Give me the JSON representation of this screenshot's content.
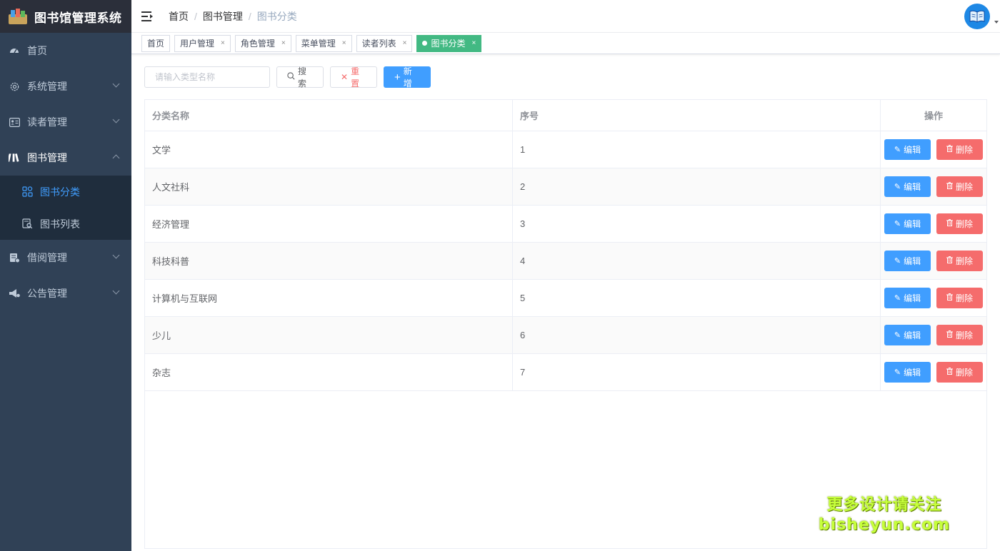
{
  "app": {
    "title": "图书馆管理系统"
  },
  "sidebar": {
    "items": [
      {
        "label": "首页",
        "icon": "dashboard-icon"
      },
      {
        "label": "系统管理",
        "icon": "gear-icon"
      },
      {
        "label": "读者管理",
        "icon": "id-card-icon"
      },
      {
        "label": "图书管理",
        "icon": "books-icon",
        "open": true,
        "children": [
          {
            "label": "图书分类",
            "icon": "category-grid-icon",
            "active": true
          },
          {
            "label": "图书列表",
            "icon": "list-search-icon"
          }
        ]
      },
      {
        "label": "借阅管理",
        "icon": "borrow-icon"
      },
      {
        "label": "公告管理",
        "icon": "megaphone-icon"
      }
    ]
  },
  "breadcrumb": [
    "首页",
    "图书管理",
    "图书分类"
  ],
  "tags": [
    {
      "label": "首页",
      "closable": false
    },
    {
      "label": "用户管理",
      "closable": true
    },
    {
      "label": "角色管理",
      "closable": true
    },
    {
      "label": "菜单管理",
      "closable": true
    },
    {
      "label": "读者列表",
      "closable": true
    },
    {
      "label": "图书分类",
      "closable": true,
      "active": true
    }
  ],
  "toolbar": {
    "search_placeholder": "请输入类型名称",
    "search_label": "搜索",
    "reset_label": "重置",
    "add_label": "新增"
  },
  "table": {
    "headers": [
      "分类名称",
      "序号",
      "操作"
    ],
    "edit_label": "编辑",
    "delete_label": "删除",
    "rows": [
      {
        "name": "文学",
        "order": "1"
      },
      {
        "name": "人文社科",
        "order": "2"
      },
      {
        "name": "经济管理",
        "order": "3"
      },
      {
        "name": "科技科普",
        "order": "4"
      },
      {
        "name": "计算机与互联网",
        "order": "5"
      },
      {
        "name": "少儿",
        "order": "6"
      },
      {
        "name": "杂志",
        "order": "7"
      }
    ]
  },
  "watermark": {
    "line1": "更多设计请关注",
    "line2": "bisheyun.com"
  },
  "colors": {
    "primary": "#409eff",
    "danger": "#f56c6c",
    "tag_active": "#42b983",
    "sidebar": "#304156"
  }
}
